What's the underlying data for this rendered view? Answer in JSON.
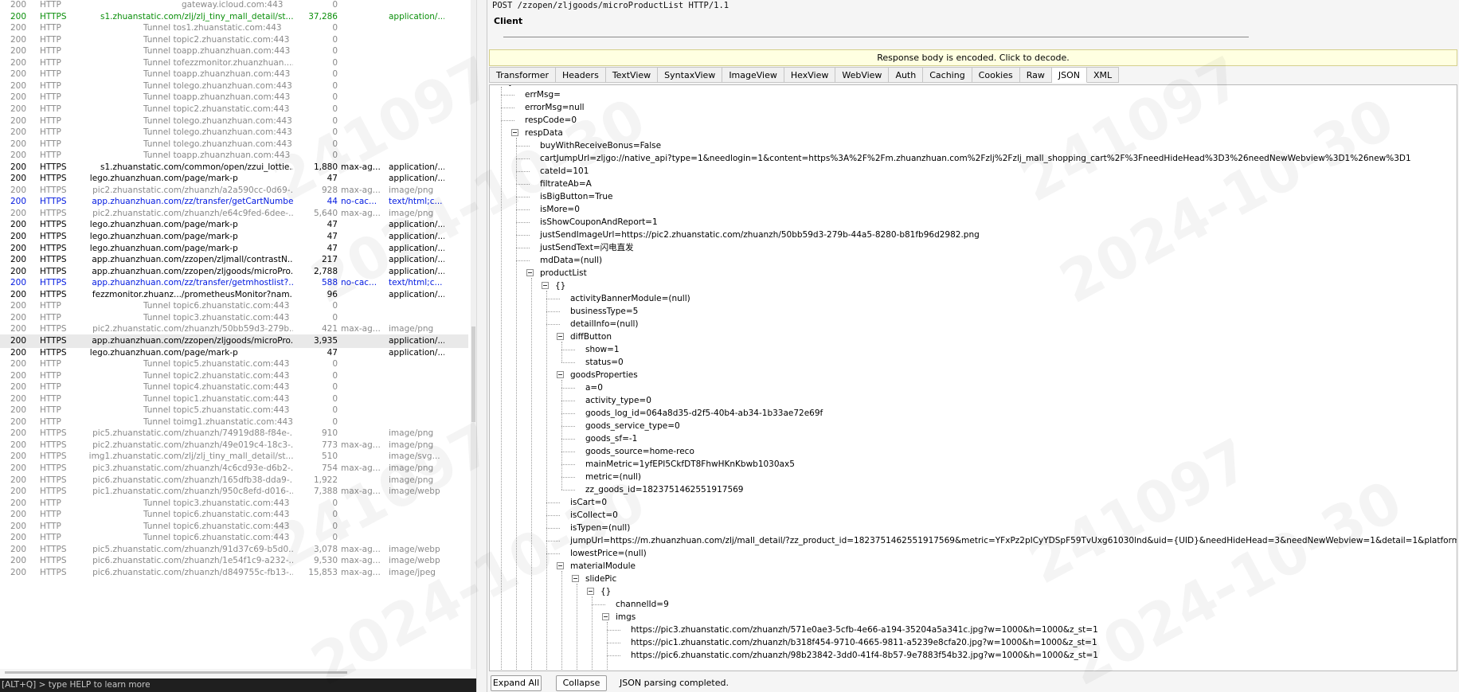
{
  "sessions": [
    {
      "result": "200",
      "protocol": "HTTP",
      "host": "",
      "url": "gateway.icloud.com:443",
      "body": "0",
      "caching": "",
      "ctype": "",
      "style": "gray"
    },
    {
      "result": "200",
      "protocol": "HTTPS",
      "host": "s1.zhuanstatic.com",
      "url": "/zlj/zlj_tiny_mall_detail/st...",
      "body": "37,286",
      "caching": "",
      "ctype": "application/...",
      "style": "green"
    },
    {
      "result": "200",
      "protocol": "HTTP",
      "host": "Tunnel to",
      "url": "s1.zhuanstatic.com:443",
      "body": "0",
      "caching": "",
      "ctype": "",
      "style": "gray"
    },
    {
      "result": "200",
      "protocol": "HTTP",
      "host": "Tunnel to",
      "url": "pic2.zhuanstatic.com:443",
      "body": "0",
      "caching": "",
      "ctype": "",
      "style": "gray"
    },
    {
      "result": "200",
      "protocol": "HTTP",
      "host": "Tunnel to",
      "url": "app.zhuanzhuan.com:443",
      "body": "0",
      "caching": "",
      "ctype": "",
      "style": "gray"
    },
    {
      "result": "200",
      "protocol": "HTTP",
      "host": "Tunnel to",
      "url": "fezzmonitor.zhuanzhuan....",
      "body": "0",
      "caching": "",
      "ctype": "",
      "style": "gray"
    },
    {
      "result": "200",
      "protocol": "HTTP",
      "host": "Tunnel to",
      "url": "app.zhuanzhuan.com:443",
      "body": "0",
      "caching": "",
      "ctype": "",
      "style": "gray"
    },
    {
      "result": "200",
      "protocol": "HTTP",
      "host": "Tunnel to",
      "url": "lego.zhuanzhuan.com:443",
      "body": "0",
      "caching": "",
      "ctype": "",
      "style": "gray"
    },
    {
      "result": "200",
      "protocol": "HTTP",
      "host": "Tunnel to",
      "url": "app.zhuanzhuan.com:443",
      "body": "0",
      "caching": "",
      "ctype": "",
      "style": "gray"
    },
    {
      "result": "200",
      "protocol": "HTTP",
      "host": "Tunnel to",
      "url": "pic2.zhuanstatic.com:443",
      "body": "0",
      "caching": "",
      "ctype": "",
      "style": "gray"
    },
    {
      "result": "200",
      "protocol": "HTTP",
      "host": "Tunnel to",
      "url": "lego.zhuanzhuan.com:443",
      "body": "0",
      "caching": "",
      "ctype": "",
      "style": "gray"
    },
    {
      "result": "200",
      "protocol": "HTTP",
      "host": "Tunnel to",
      "url": "lego.zhuanzhuan.com:443",
      "body": "0",
      "caching": "",
      "ctype": "",
      "style": "gray"
    },
    {
      "result": "200",
      "protocol": "HTTP",
      "host": "Tunnel to",
      "url": "lego.zhuanzhuan.com:443",
      "body": "0",
      "caching": "",
      "ctype": "",
      "style": "gray"
    },
    {
      "result": "200",
      "protocol": "HTTP",
      "host": "Tunnel to",
      "url": "app.zhuanzhuan.com:443",
      "body": "0",
      "caching": "",
      "ctype": "",
      "style": "gray"
    },
    {
      "result": "200",
      "protocol": "HTTPS",
      "host": "s1.zhuanstatic.com",
      "url": "/common/open/zzui_lottie...",
      "body": "1,880",
      "caching": "max-ag...",
      "ctype": "application/...",
      "style": "dark"
    },
    {
      "result": "200",
      "protocol": "HTTPS",
      "host": "lego.zhuanzhuan.com",
      "url": "/page/mark-p",
      "body": "47",
      "caching": "",
      "ctype": "application/...",
      "style": "dark"
    },
    {
      "result": "200",
      "protocol": "HTTPS",
      "host": "pic2.zhuanstatic.com",
      "url": "/zhuanzh/a2a590cc-0d69-...",
      "body": "928",
      "caching": "max-ag...",
      "ctype": "image/png",
      "style": "gray"
    },
    {
      "result": "200",
      "protocol": "HTTPS",
      "host": "app.zhuanzhuan.com",
      "url": "/zz/transfer/getCartNumber",
      "body": "44",
      "caching": "no-cac...",
      "ctype": "text/html;c...",
      "style": "blue"
    },
    {
      "result": "200",
      "protocol": "HTTPS",
      "host": "pic2.zhuanstatic.com",
      "url": "/zhuanzh/e64c9fed-6dee-...",
      "body": "5,640",
      "caching": "max-ag...",
      "ctype": "image/png",
      "style": "gray"
    },
    {
      "result": "200",
      "protocol": "HTTPS",
      "host": "lego.zhuanzhuan.com",
      "url": "/page/mark-p",
      "body": "47",
      "caching": "",
      "ctype": "application/...",
      "style": "dark"
    },
    {
      "result": "200",
      "protocol": "HTTPS",
      "host": "lego.zhuanzhuan.com",
      "url": "/page/mark-p",
      "body": "47",
      "caching": "",
      "ctype": "application/...",
      "style": "dark"
    },
    {
      "result": "200",
      "protocol": "HTTPS",
      "host": "lego.zhuanzhuan.com",
      "url": "/page/mark-p",
      "body": "47",
      "caching": "",
      "ctype": "application/...",
      "style": "dark"
    },
    {
      "result": "200",
      "protocol": "HTTPS",
      "host": "app.zhuanzhuan.com",
      "url": "/zzopen/zljmall/contrastN...",
      "body": "217",
      "caching": "",
      "ctype": "application/...",
      "style": "dark"
    },
    {
      "result": "200",
      "protocol": "HTTPS",
      "host": "app.zhuanzhuan.com",
      "url": "/zzopen/zljgoods/microPro...",
      "body": "2,788",
      "caching": "",
      "ctype": "application/...",
      "style": "dark"
    },
    {
      "result": "200",
      "protocol": "HTTPS",
      "host": "app.zhuanzhuan.com",
      "url": "/zz/transfer/getmhostlist?...",
      "body": "588",
      "caching": "no-cac...",
      "ctype": "text/html;c...",
      "style": "blue"
    },
    {
      "result": "200",
      "protocol": "HTTPS",
      "host": "fezzmonitor.zhuanz...",
      "url": "/prometheusMonitor?nam...",
      "body": "96",
      "caching": "",
      "ctype": "application/...",
      "style": "dark"
    },
    {
      "result": "200",
      "protocol": "HTTP",
      "host": "Tunnel to",
      "url": "pic6.zhuanstatic.com:443",
      "body": "0",
      "caching": "",
      "ctype": "",
      "style": "gray"
    },
    {
      "result": "200",
      "protocol": "HTTP",
      "host": "Tunnel to",
      "url": "pic3.zhuanstatic.com:443",
      "body": "0",
      "caching": "",
      "ctype": "",
      "style": "gray"
    },
    {
      "result": "200",
      "protocol": "HTTPS",
      "host": "pic2.zhuanstatic.com",
      "url": "/zhuanzh/50bb59d3-279b...",
      "body": "421",
      "caching": "max-ag...",
      "ctype": "image/png",
      "style": "gray"
    },
    {
      "result": "200",
      "protocol": "HTTPS",
      "host": "app.zhuanzhuan.com",
      "url": "/zzopen/zljgoods/microPro...",
      "body": "3,935",
      "caching": "",
      "ctype": "application/...",
      "style": "dark",
      "selected": true
    },
    {
      "result": "200",
      "protocol": "HTTPS",
      "host": "lego.zhuanzhuan.com",
      "url": "/page/mark-p",
      "body": "47",
      "caching": "",
      "ctype": "application/...",
      "style": "dark"
    },
    {
      "result": "200",
      "protocol": "HTTP",
      "host": "Tunnel to",
      "url": "pic5.zhuanstatic.com:443",
      "body": "0",
      "caching": "",
      "ctype": "",
      "style": "gray"
    },
    {
      "result": "200",
      "protocol": "HTTP",
      "host": "Tunnel to",
      "url": "pic2.zhuanstatic.com:443",
      "body": "0",
      "caching": "",
      "ctype": "",
      "style": "gray"
    },
    {
      "result": "200",
      "protocol": "HTTP",
      "host": "Tunnel to",
      "url": "pic4.zhuanstatic.com:443",
      "body": "0",
      "caching": "",
      "ctype": "",
      "style": "gray"
    },
    {
      "result": "200",
      "protocol": "HTTP",
      "host": "Tunnel to",
      "url": "pic1.zhuanstatic.com:443",
      "body": "0",
      "caching": "",
      "ctype": "",
      "style": "gray"
    },
    {
      "result": "200",
      "protocol": "HTTP",
      "host": "Tunnel to",
      "url": "pic5.zhuanstatic.com:443",
      "body": "0",
      "caching": "",
      "ctype": "",
      "style": "gray"
    },
    {
      "result": "200",
      "protocol": "HTTP",
      "host": "Tunnel to",
      "url": "img1.zhuanstatic.com:443",
      "body": "0",
      "caching": "",
      "ctype": "",
      "style": "gray"
    },
    {
      "result": "200",
      "protocol": "HTTPS",
      "host": "pic5.zhuanstatic.com",
      "url": "/zhuanzh/74919d88-f84e-...",
      "body": "910",
      "caching": "",
      "ctype": "image/png",
      "style": "gray"
    },
    {
      "result": "200",
      "protocol": "HTTPS",
      "host": "pic2.zhuanstatic.com",
      "url": "/zhuanzh/49e019c4-18c3-...",
      "body": "773",
      "caching": "max-ag...",
      "ctype": "image/png",
      "style": "gray"
    },
    {
      "result": "200",
      "protocol": "HTTPS",
      "host": "img1.zhuanstatic.com",
      "url": "/zlj/zlj_tiny_mall_detail/st...",
      "body": "510",
      "caching": "",
      "ctype": "image/svg...",
      "style": "gray"
    },
    {
      "result": "200",
      "protocol": "HTTPS",
      "host": "pic3.zhuanstatic.com",
      "url": "/zhuanzh/4c6cd93e-d6b2-...",
      "body": "754",
      "caching": "max-ag...",
      "ctype": "image/png",
      "style": "gray"
    },
    {
      "result": "200",
      "protocol": "HTTPS",
      "host": "pic6.zhuanstatic.com",
      "url": "/zhuanzh/165dfb38-dda9-...",
      "body": "1,922",
      "caching": "",
      "ctype": "image/png",
      "style": "gray"
    },
    {
      "result": "200",
      "protocol": "HTTPS",
      "host": "pic1.zhuanstatic.com",
      "url": "/zhuanzh/950c8efd-d016-...",
      "body": "7,388",
      "caching": "max-ag...",
      "ctype": "image/webp",
      "style": "gray"
    },
    {
      "result": "200",
      "protocol": "HTTP",
      "host": "Tunnel to",
      "url": "pic3.zhuanstatic.com:443",
      "body": "0",
      "caching": "",
      "ctype": "",
      "style": "gray"
    },
    {
      "result": "200",
      "protocol": "HTTP",
      "host": "Tunnel to",
      "url": "pic6.zhuanstatic.com:443",
      "body": "0",
      "caching": "",
      "ctype": "",
      "style": "gray"
    },
    {
      "result": "200",
      "protocol": "HTTP",
      "host": "Tunnel to",
      "url": "pic6.zhuanstatic.com:443",
      "body": "0",
      "caching": "",
      "ctype": "",
      "style": "gray"
    },
    {
      "result": "200",
      "protocol": "HTTP",
      "host": "Tunnel to",
      "url": "pic6.zhuanstatic.com:443",
      "body": "0",
      "caching": "",
      "ctype": "",
      "style": "gray"
    },
    {
      "result": "200",
      "protocol": "HTTPS",
      "host": "pic5.zhuanstatic.com",
      "url": "/zhuanzh/91d37c69-b5d0...",
      "body": "3,078",
      "caching": "max-ag...",
      "ctype": "image/webp",
      "style": "gray"
    },
    {
      "result": "200",
      "protocol": "HTTPS",
      "host": "pic6.zhuanstatic.com",
      "url": "/zhuanzh/1e54f1c9-a232-...",
      "body": "9,530",
      "caching": "max-ag...",
      "ctype": "image/webp",
      "style": "gray"
    },
    {
      "result": "200",
      "protocol": "HTTPS",
      "host": "pic6.zhuanstatic.com",
      "url": "/zhuanzh/d849755c-fb13-...",
      "body": "15,853",
      "caching": "max-ag...",
      "ctype": "image/jpeg",
      "style": "gray"
    }
  ],
  "quickexec": "[ALT+Q] > type HELP to learn more",
  "inspector": {
    "request_line": "POST /zzopen/zljgoods/microProductList HTTP/1.1",
    "client_label": "Client",
    "decode_bar": "Response body is encoded. Click to decode.",
    "tabs": [
      "Transformer",
      "Headers",
      "TextView",
      "SyntaxView",
      "ImageView",
      "HexView",
      "WebView",
      "Auth",
      "Caching",
      "Cookies",
      "Raw",
      "JSON",
      "XML"
    ],
    "active_tab": "JSON",
    "tree": [
      {
        "d": 0,
        "t": "JSON",
        "box": true
      },
      {
        "d": 1,
        "t": "errMsg="
      },
      {
        "d": 1,
        "t": "errorMsg=null"
      },
      {
        "d": 1,
        "t": "respCode=0"
      },
      {
        "d": 1,
        "t": "respData",
        "box": true
      },
      {
        "d": 2,
        "t": "buyWithReceiveBonus=False"
      },
      {
        "d": 2,
        "t": "cartJumpUrl=zljgo://native_api?type=1&needlogin=1&content=https%3A%2F%2Fm.zhuanzhuan.com%2Fzlj%2Fzlj_mall_shopping_cart%2F%3FneedHideHead%3D3%26needNewWebview%3D1%26new%3D1"
      },
      {
        "d": 2,
        "t": "cateId=101"
      },
      {
        "d": 2,
        "t": "filtrateAb=A"
      },
      {
        "d": 2,
        "t": "isBigButton=True"
      },
      {
        "d": 2,
        "t": "isMore=0"
      },
      {
        "d": 2,
        "t": "isShowCouponAndReport=1"
      },
      {
        "d": 2,
        "t": "justSendImageUrl=https://pic2.zhuanstatic.com/zhuanzh/50bb59d3-279b-44a5-8280-b81fb96d2982.png"
      },
      {
        "d": 2,
        "t": "justSendText=闪电直发"
      },
      {
        "d": 2,
        "t": "mdData=(null)"
      },
      {
        "d": 2,
        "t": "productList",
        "box": true
      },
      {
        "d": 3,
        "t": "{}",
        "box": true
      },
      {
        "d": 4,
        "t": "activityBannerModule=(null)"
      },
      {
        "d": 4,
        "t": "businessType=5"
      },
      {
        "d": 4,
        "t": "detailInfo=(null)"
      },
      {
        "d": 4,
        "t": "diffButton",
        "box": true
      },
      {
        "d": 5,
        "t": "show=1"
      },
      {
        "d": 5,
        "t": "status=0"
      },
      {
        "d": 4,
        "t": "goodsProperties",
        "box": true
      },
      {
        "d": 5,
        "t": "a=0"
      },
      {
        "d": 5,
        "t": "activity_type=0"
      },
      {
        "d": 5,
        "t": "goods_log_id=064a8d35-d2f5-40b4-ab34-1b33ae72e69f"
      },
      {
        "d": 5,
        "t": "goods_service_type=0"
      },
      {
        "d": 5,
        "t": "goods_sf=-1"
      },
      {
        "d": 5,
        "t": "goods_source=home-reco"
      },
      {
        "d": 5,
        "t": "mainMetric=1yfEPI5CkfDT8FhwHKnKbwb1030ax5"
      },
      {
        "d": 5,
        "t": "metric=(null)"
      },
      {
        "d": 5,
        "t": "zz_goods_id=1823751462551917569"
      },
      {
        "d": 4,
        "t": "isCart=0"
      },
      {
        "d": 4,
        "t": "isCollect=0"
      },
      {
        "d": 4,
        "t": "isTypen=(null)"
      },
      {
        "d": 4,
        "t": "jumpUrl=https://m.zhuanzhuan.com/zlj/mall_detail/?zz_product_id=1823751462551917569&metric=YFxPz2pICyYDSpF59TvUxg61030lnd&uid={UID}&needHideHead=3&needNewWebview=1&detail=1&platform=zlj"
      },
      {
        "d": 4,
        "t": "lowestPrice=(null)"
      },
      {
        "d": 4,
        "t": "materialModule",
        "box": true
      },
      {
        "d": 5,
        "t": "slidePic",
        "box": true
      },
      {
        "d": 6,
        "t": "{}",
        "box": true
      },
      {
        "d": 7,
        "t": "channelId=9"
      },
      {
        "d": 7,
        "t": "imgs",
        "box": true
      },
      {
        "d": 8,
        "t": "https://pic3.zhuanstatic.com/zhuanzh/571e0ae3-5cfb-4e66-a194-35204a5a341c.jpg?w=1000&h=1000&z_st=1"
      },
      {
        "d": 8,
        "t": "https://pic1.zhuanstatic.com/zhuanzh/b318f454-9710-4665-9811-a5239e8cfa20.jpg?w=1000&h=1000&z_st=1"
      },
      {
        "d": 8,
        "t": "https://pic6.zhuanstatic.com/zhuanzh/98b23842-3dd0-41f4-8b57-9e7883f54b32.jpg?w=1000&h=1000&z_st=1"
      }
    ],
    "expand_all": "Expand All",
    "collapse": "Collapse",
    "status": "JSON parsing completed."
  },
  "watermark": [
    "241097",
    "2024-10-30"
  ],
  "colors": {
    "green": "#0b8f0b",
    "blue": "#0018e0",
    "gray": "#8a8a8a",
    "selected_row": "#e9e9e9",
    "decode_bar": "#ffffe1"
  }
}
